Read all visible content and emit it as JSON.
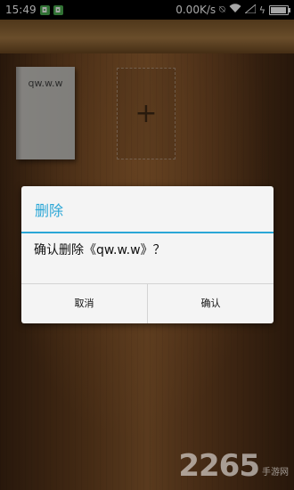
{
  "status_bar": {
    "time": "15:49",
    "app_icon_1": "app-icon",
    "app_icon_2": "app-icon",
    "network_speed": "0.00K/s",
    "icons": [
      "alarm-off-icon",
      "wifi-icon",
      "signal-icon",
      "charging-icon",
      "battery-icon"
    ],
    "battery_level": 0.85
  },
  "shelf": {
    "books": [
      {
        "title": "qw.w.w"
      }
    ],
    "add_icon": "plus-icon"
  },
  "dialog": {
    "title": "删除",
    "message": "确认删除《qw.w.w》？",
    "cancel_label": "取消",
    "confirm_label": "确认",
    "accent_color": "#2aa6d6"
  },
  "watermark": {
    "number": "2265",
    "text": "手游网"
  }
}
